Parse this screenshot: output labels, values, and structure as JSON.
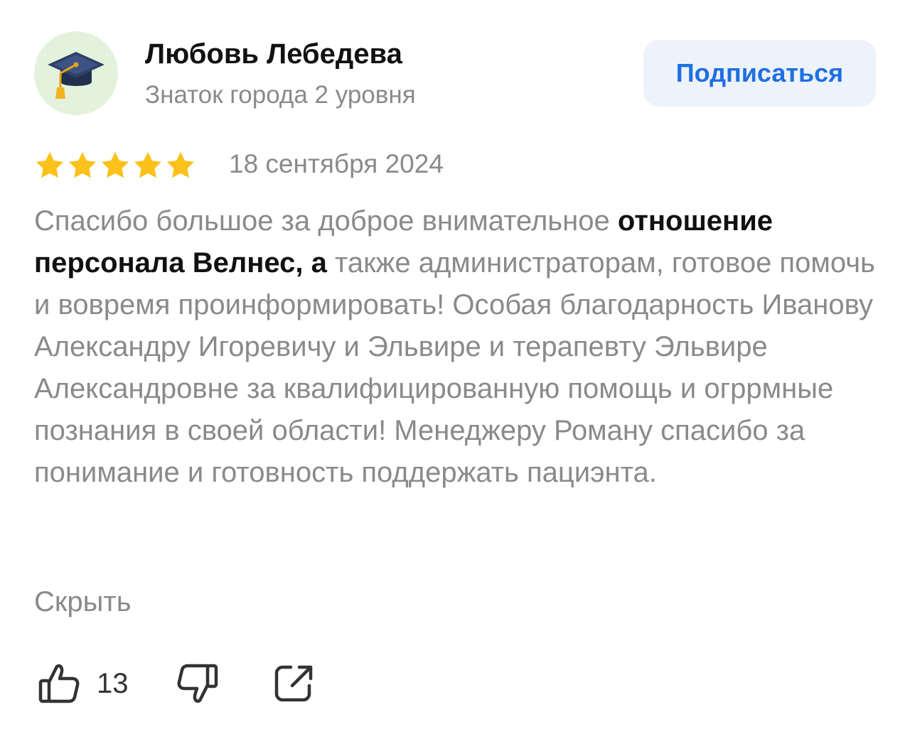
{
  "author": {
    "name": "Любовь Лебедева",
    "level": "Знаток города 2 уровня",
    "avatar_icon": "graduation-cap-icon",
    "avatar_bg": "#e3f2dc"
  },
  "subscribe_label": "Подписаться",
  "review": {
    "rating": 5,
    "rating_max": 5,
    "date": "18 сентября 2024",
    "text_part1": "Спасибо большое за доброе внимательное ",
    "text_bold": "отношение персонала Велнес, а",
    "text_part2": " также администраторам, готовое помочь и вовремя проинформировать! Особая благодарность Иванову Александру Игоревичу и Эльвире и терапевту Эльвире Александровне за квалифицированную помощь и огррмные познания в своей области! Менеджеру Роману спасибо за понимание и готовность поддержать пациэнта.",
    "hide_label": "Скрыть"
  },
  "actions": {
    "like_icon": "thumbs-up-icon",
    "like_count": "13",
    "dislike_icon": "thumbs-down-icon",
    "share_icon": "share-icon"
  },
  "colors": {
    "star": "#fcc21b",
    "accent": "#1f6fe0",
    "button_bg": "#edf2fb",
    "muted_text": "#8a8a8a"
  }
}
